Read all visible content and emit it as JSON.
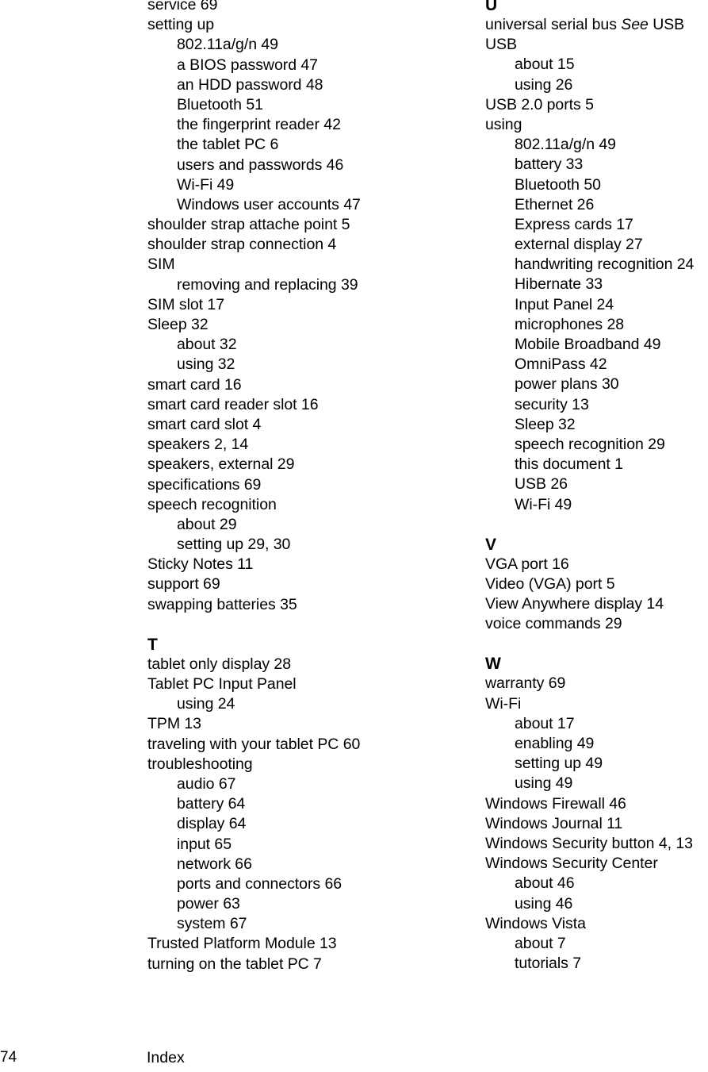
{
  "document": {
    "type": "book-index",
    "footer": {
      "page_number": "74",
      "running_head": "Index"
    }
  },
  "columns": [
    {
      "id": "left",
      "sections": [
        {
          "heading": "",
          "entries": [
            {
              "level": 1,
              "text": "service 69"
            },
            {
              "level": 1,
              "text": "setting up"
            },
            {
              "level": 2,
              "text": "802.11a/g/n 49"
            },
            {
              "level": 2,
              "text": "a BIOS password 47"
            },
            {
              "level": 2,
              "text": "an HDD password 48"
            },
            {
              "level": 2,
              "text": "Bluetooth 51"
            },
            {
              "level": 2,
              "text": "the fingerprint reader 42"
            },
            {
              "level": 2,
              "text": "the tablet PC 6"
            },
            {
              "level": 2,
              "text": "users and passwords 46"
            },
            {
              "level": 2,
              "text": "Wi-Fi 49"
            },
            {
              "level": 2,
              "text": "Windows user accounts 47"
            },
            {
              "level": 1,
              "text": "shoulder strap attache point 5"
            },
            {
              "level": 1,
              "text": "shoulder strap connection 4"
            },
            {
              "level": 1,
              "text": "SIM"
            },
            {
              "level": 2,
              "text": "removing and replacing 39"
            },
            {
              "level": 1,
              "text": "SIM slot 17"
            },
            {
              "level": 1,
              "text": "Sleep 32"
            },
            {
              "level": 2,
              "text": "about 32"
            },
            {
              "level": 2,
              "text": "using 32"
            },
            {
              "level": 1,
              "text": "smart card 16"
            },
            {
              "level": 1,
              "text": "smart card reader slot 16"
            },
            {
              "level": 1,
              "text": "smart card slot 4"
            },
            {
              "level": 1,
              "text": "speakers 2, 14"
            },
            {
              "level": 1,
              "text": "speakers, external 29"
            },
            {
              "level": 1,
              "text": "specifications 69"
            },
            {
              "level": 1,
              "text": "speech recognition"
            },
            {
              "level": 2,
              "text": "about 29"
            },
            {
              "level": 2,
              "text": "setting up 29, 30"
            },
            {
              "level": 1,
              "text": "Sticky Notes 11"
            },
            {
              "level": 1,
              "text": "support 69"
            },
            {
              "level": 1,
              "text": "swapping batteries 35"
            }
          ]
        },
        {
          "heading": "T",
          "entries": [
            {
              "level": 1,
              "text": "tablet only display 28"
            },
            {
              "level": 1,
              "text": "Tablet PC Input Panel"
            },
            {
              "level": 2,
              "text": "using 24"
            },
            {
              "level": 1,
              "text": "TPM 13"
            },
            {
              "level": 1,
              "text": "traveling with your tablet PC 60"
            },
            {
              "level": 1,
              "text": "troubleshooting"
            },
            {
              "level": 2,
              "text": "audio 67"
            },
            {
              "level": 2,
              "text": "battery 64"
            },
            {
              "level": 2,
              "text": "display 64"
            },
            {
              "level": 2,
              "text": "input 65"
            },
            {
              "level": 2,
              "text": "network 66"
            },
            {
              "level": 2,
              "text": "ports and connectors 66"
            },
            {
              "level": 2,
              "text": "power 63"
            },
            {
              "level": 2,
              "text": "system 67"
            },
            {
              "level": 1,
              "text": "Trusted Platform Module 13"
            },
            {
              "level": 1,
              "text": "turning on the tablet PC 7"
            }
          ]
        }
      ]
    },
    {
      "id": "right",
      "sections": [
        {
          "heading": "U",
          "entries": [
            {
              "level": 1,
              "text": "universal serial bus ",
              "italic_segment": "See",
              "text_after": " USB"
            },
            {
              "level": 1,
              "text": "USB"
            },
            {
              "level": 2,
              "text": "about 15"
            },
            {
              "level": 2,
              "text": "using 26"
            },
            {
              "level": 1,
              "text": "USB 2.0 ports 5"
            },
            {
              "level": 1,
              "text": "using"
            },
            {
              "level": 2,
              "text": "802.11a/g/n 49"
            },
            {
              "level": 2,
              "text": "battery 33"
            },
            {
              "level": 2,
              "text": "Bluetooth 50"
            },
            {
              "level": 2,
              "text": "Ethernet 26"
            },
            {
              "level": 2,
              "text": "Express cards 17"
            },
            {
              "level": 2,
              "text": "external display 27"
            },
            {
              "level": 2,
              "text": "handwriting recognition 24"
            },
            {
              "level": 2,
              "text": "Hibernate 33"
            },
            {
              "level": 2,
              "text": "Input Panel 24"
            },
            {
              "level": 2,
              "text": "microphones 28"
            },
            {
              "level": 2,
              "text": "Mobile Broadband 49"
            },
            {
              "level": 2,
              "text": "OmniPass 42"
            },
            {
              "level": 2,
              "text": "power plans 30"
            },
            {
              "level": 2,
              "text": "security 13"
            },
            {
              "level": 2,
              "text": "Sleep 32"
            },
            {
              "level": 2,
              "text": "speech recognition 29"
            },
            {
              "level": 2,
              "text": "this document 1"
            },
            {
              "level": 2,
              "text": "USB 26"
            },
            {
              "level": 2,
              "text": "Wi-Fi 49"
            }
          ]
        },
        {
          "heading": "V",
          "entries": [
            {
              "level": 1,
              "text": "VGA port 16"
            },
            {
              "level": 1,
              "text": "Video (VGA) port 5"
            },
            {
              "level": 1,
              "text": "View Anywhere display 14"
            },
            {
              "level": 1,
              "text": "voice commands 29"
            }
          ]
        },
        {
          "heading": "W",
          "entries": [
            {
              "level": 1,
              "text": "warranty 69"
            },
            {
              "level": 1,
              "text": "Wi-Fi"
            },
            {
              "level": 2,
              "text": "about 17"
            },
            {
              "level": 2,
              "text": "enabling 49"
            },
            {
              "level": 2,
              "text": "setting up 49"
            },
            {
              "level": 2,
              "text": "using 49"
            },
            {
              "level": 1,
              "text": "Windows Firewall 46"
            },
            {
              "level": 1,
              "text": "Windows Journal 11"
            },
            {
              "level": 1,
              "text": "Windows Security button 4, 13"
            },
            {
              "level": 1,
              "text": "Windows Security Center"
            },
            {
              "level": 2,
              "text": "about 46"
            },
            {
              "level": 2,
              "text": "using 46"
            },
            {
              "level": 1,
              "text": "Windows Vista"
            },
            {
              "level": 2,
              "text": "about 7"
            },
            {
              "level": 2,
              "text": "tutorials 7"
            }
          ]
        }
      ]
    }
  ]
}
